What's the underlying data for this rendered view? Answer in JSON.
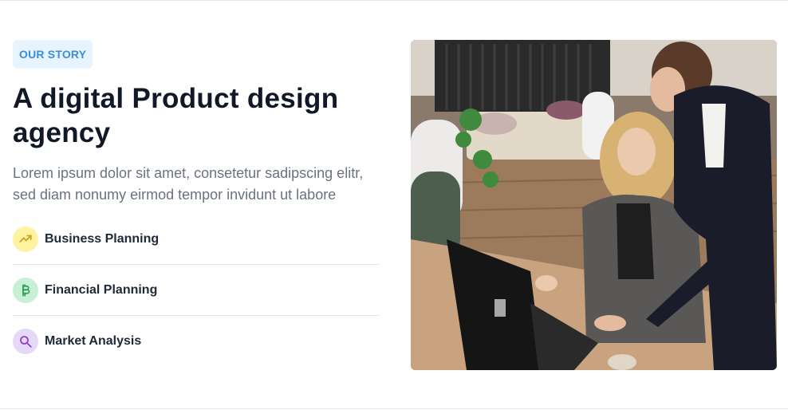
{
  "section": {
    "badge": "OUR STORY",
    "title": "A digital Product design agency",
    "description": "Lorem ipsum dolor sit amet, consetetur sadipscing elitr, sed diam nonumy eirmod tempor invidunt ut labore"
  },
  "features": [
    {
      "label": "Business Planning",
      "icon": "trending-up-icon",
      "bg": "#fef3a0",
      "fg": "#d4a017"
    },
    {
      "label": "Financial Planning",
      "icon": "bitcoin-icon",
      "bg": "#c8f0d4",
      "fg": "#2e9e57"
    },
    {
      "label": "Market Analysis",
      "icon": "search-icon",
      "bg": "#e6d9f7",
      "fg": "#8e44c8"
    }
  ],
  "colors": {
    "heading": "#111827",
    "body_text": "#6b7280",
    "badge_bg": "#e8f4fd",
    "badge_text": "#3a8fd6"
  }
}
